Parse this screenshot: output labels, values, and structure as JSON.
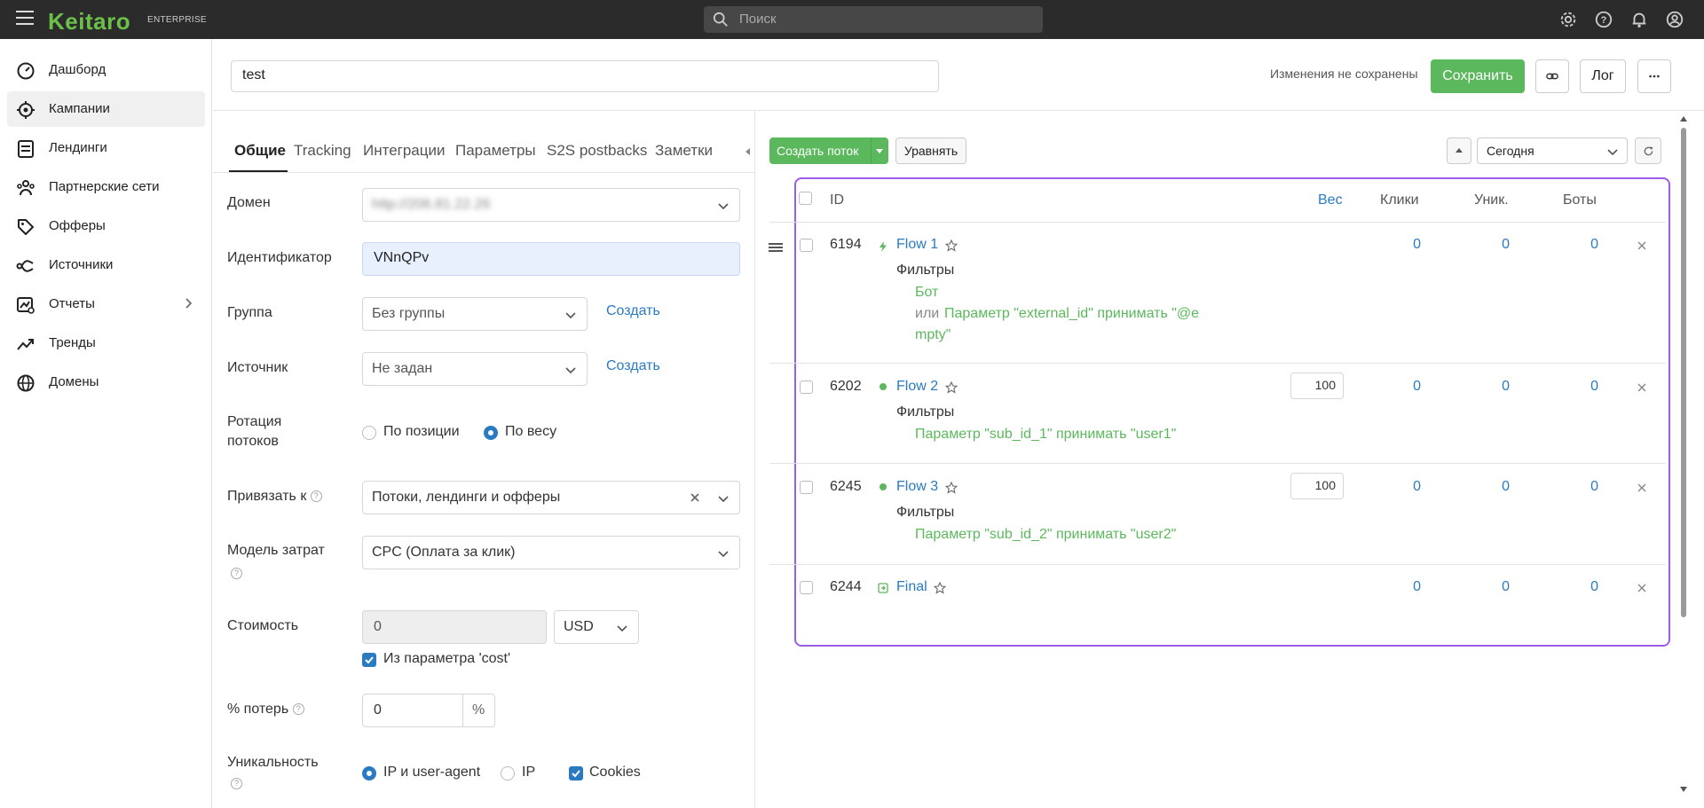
{
  "app": {
    "logo": "Keitaro",
    "edition": "ENTERPRISE"
  },
  "search": {
    "placeholder": "Поиск"
  },
  "top_icons": [
    "gear-icon",
    "help-icon",
    "bell-icon",
    "user-icon"
  ],
  "sidebar": {
    "items": [
      {
        "label": "Дашборд",
        "icon": "dashboard-icon"
      },
      {
        "label": "Кампании",
        "icon": "target-icon",
        "active": true
      },
      {
        "label": "Лендинги",
        "icon": "landing-icon"
      },
      {
        "label": "Партнерские сети",
        "icon": "partners-icon"
      },
      {
        "label": "Офферы",
        "icon": "tag-icon"
      },
      {
        "label": "Источники",
        "icon": "sources-icon"
      },
      {
        "label": "Отчеты",
        "icon": "reports-icon"
      },
      {
        "label": "Тренды",
        "icon": "trend-icon"
      },
      {
        "label": "Домены",
        "icon": "globe-icon"
      }
    ]
  },
  "campaign": {
    "name": "test",
    "unsaved_text": "Изменения не сохранены",
    "save_label": "Сохранить",
    "log_label": "Лог"
  },
  "tabs": [
    "Общие",
    "Tracking",
    "Интеграции",
    "Параметры",
    "S2S postbacks",
    "Заметки"
  ],
  "form": {
    "domain_label": "Домен",
    "domain_value": "http://206.81.22.26",
    "identifier_label": "Идентификатор",
    "identifier_value": "VNnQPv",
    "group_label": "Группа",
    "group_value": "Без группы",
    "source_label": "Источник",
    "source_value": "Не задан",
    "create_label": "Создать",
    "rotation_label_1": "Ротация",
    "rotation_label_2": "потоков",
    "rotation_option_position": "По позиции",
    "rotation_option_weight": "По весу",
    "bind_label": "Привязать к",
    "bind_value": "Потоки, лендинги и офферы",
    "cost_model_label": "Модель затрат",
    "cost_model_value": "CPC (Оплата за клик)",
    "cost_label": "Стоимость",
    "cost_value": "0",
    "currency_value": "USD",
    "cost_from_param_label": "Из параметра 'cost'",
    "loss_label": "% потерь",
    "loss_value": "0",
    "loss_unit": "%",
    "uniqueness_label": "Уникальность",
    "uniq_ip_ua": "IP и user-agent",
    "uniq_ip": "IP",
    "uniq_cookies": "Cookies"
  },
  "flows_toolbar": {
    "create_flow_label": "Создать поток",
    "equalize_label": "Уравнять",
    "date_value": "Сегодня"
  },
  "flows_table": {
    "headers": {
      "id": "ID",
      "weight": "Вес",
      "clicks": "Клики",
      "uniq": "Уник.",
      "bots": "Боты"
    },
    "filters_label": "Фильтры",
    "flows": [
      {
        "id": "6194",
        "name": "Flow 1",
        "clicks": "0",
        "uniq": "0",
        "bots": "0",
        "filter_1": "Бот",
        "filter_or": "или",
        "filter_2a": "Параметр \"external_id\"  принимать \"@e",
        "filter_2b": "mpty\""
      },
      {
        "id": "6202",
        "name": "Flow 2",
        "weight": "100",
        "clicks": "0",
        "uniq": "0",
        "bots": "0",
        "filter_1": "Параметр \"sub_id_1\"  принимать \"user1\""
      },
      {
        "id": "6245",
        "name": "Flow 3",
        "weight": "100",
        "clicks": "0",
        "uniq": "0",
        "bots": "0",
        "filter_1": "Параметр \"sub_id_2\"  принимать \"user2\""
      },
      {
        "id": "6244",
        "name": "Final",
        "clicks": "0",
        "uniq": "0",
        "bots": "0"
      }
    ]
  },
  "colors": {
    "accent_green": "#5cb85c",
    "link_blue": "#2a7ac2",
    "highlight_purple": "#9b5de5",
    "topbar": "#2b2b2b"
  }
}
